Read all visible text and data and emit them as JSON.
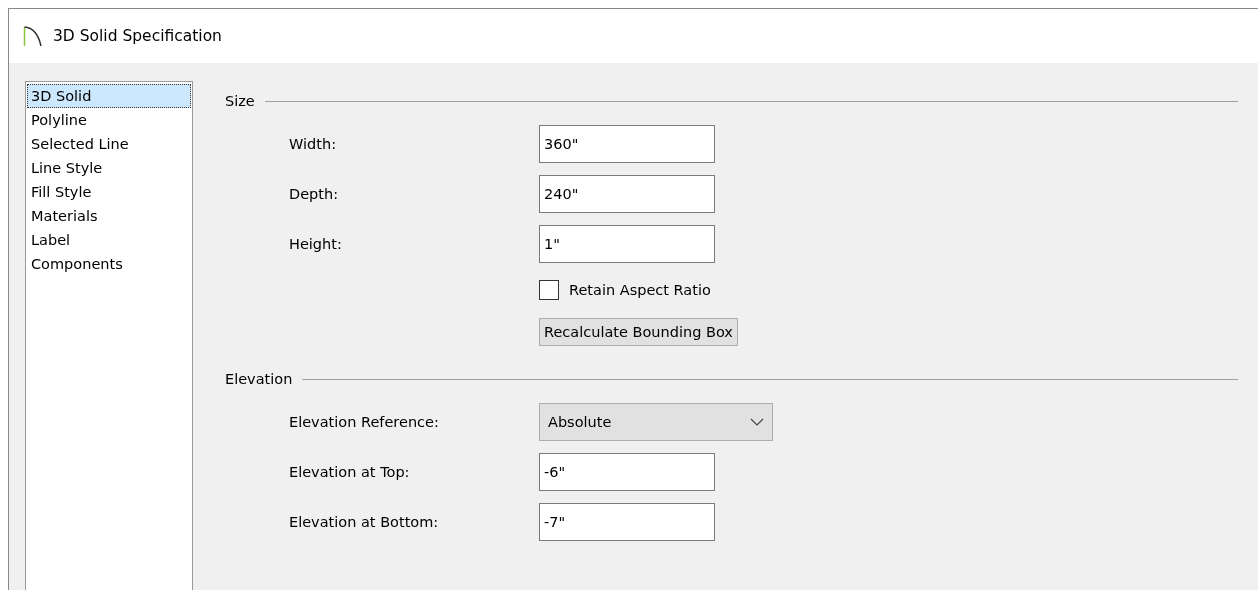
{
  "window": {
    "title": "3D Solid Specification"
  },
  "sidebar": {
    "items": [
      {
        "label": "3D Solid",
        "selected": true
      },
      {
        "label": "Polyline",
        "selected": false
      },
      {
        "label": "Selected Line",
        "selected": false
      },
      {
        "label": "Line Style",
        "selected": false
      },
      {
        "label": "Fill Style",
        "selected": false
      },
      {
        "label": "Materials",
        "selected": false
      },
      {
        "label": "Label",
        "selected": false
      },
      {
        "label": "Components",
        "selected": false
      }
    ]
  },
  "sections": [
    {
      "title": "Size",
      "rows": [
        {
          "kind": "field",
          "label": "Width:",
          "value": "360\""
        },
        {
          "kind": "field",
          "label": "Depth:",
          "value": "240\""
        },
        {
          "kind": "field",
          "label": "Height:",
          "value": "1\""
        },
        {
          "kind": "checkbox",
          "label": "Retain Aspect Ratio",
          "checked": false
        },
        {
          "kind": "button",
          "label": "Recalculate Bounding Box"
        }
      ]
    },
    {
      "title": "Elevation",
      "rows": [
        {
          "kind": "dropdown",
          "label": "Elevation Reference:",
          "value": "Absolute"
        },
        {
          "kind": "field",
          "label": "Elevation at Top:",
          "value": "-6\""
        },
        {
          "kind": "field",
          "label": "Elevation at Bottom:",
          "value": "-7\""
        }
      ]
    }
  ]
}
